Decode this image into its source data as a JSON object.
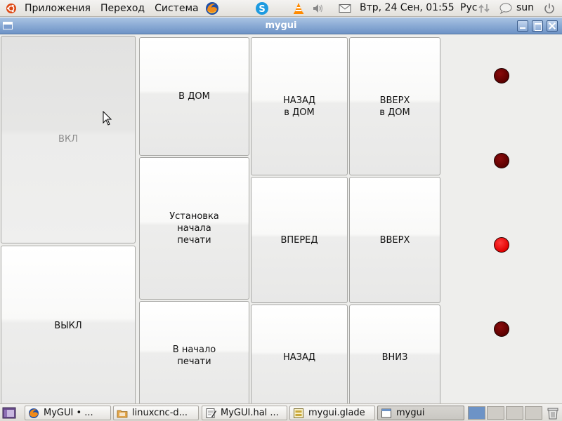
{
  "top_panel": {
    "menu": [
      "Приложения",
      "Переход",
      "Система"
    ],
    "clock": "Втр, 24 Сен, 01:55",
    "keyboard_layout": "Рус",
    "username": "sun",
    "tray_icons": [
      "skype-icon",
      "vlc-icon",
      "volume-icon",
      "mail-icon",
      "network-icon",
      "chat-icon",
      "power-icon"
    ]
  },
  "window": {
    "title": "mygui"
  },
  "buttons": {
    "on": "ВКЛ",
    "off": "ВЫКЛ",
    "home": "В ДОМ",
    "set_print_start": "Установка\nначала\nпечати",
    "to_print_start": "В начало\nпечати",
    "back_home": "НАЗАД\nв  ДОМ",
    "up_home": "ВВЕРХ\nв ДОМ",
    "forward": "ВПЕРЕД",
    "up": "ВВЕРХ",
    "back": "НАЗАД",
    "down": "ВНИЗ"
  },
  "indicators": [
    {
      "state": "off",
      "color": "#6b0000"
    },
    {
      "state": "off",
      "color": "#6b0000"
    },
    {
      "state": "on",
      "color": "#ff1010"
    },
    {
      "state": "off",
      "color": "#6b0000"
    }
  ],
  "taskbar": {
    "tasks": [
      "MyGUI • ...",
      "linuxcnc-d...",
      "MyGUI.hal ...",
      "mygui.glade",
      "mygui"
    ],
    "active_task": "mygui"
  }
}
